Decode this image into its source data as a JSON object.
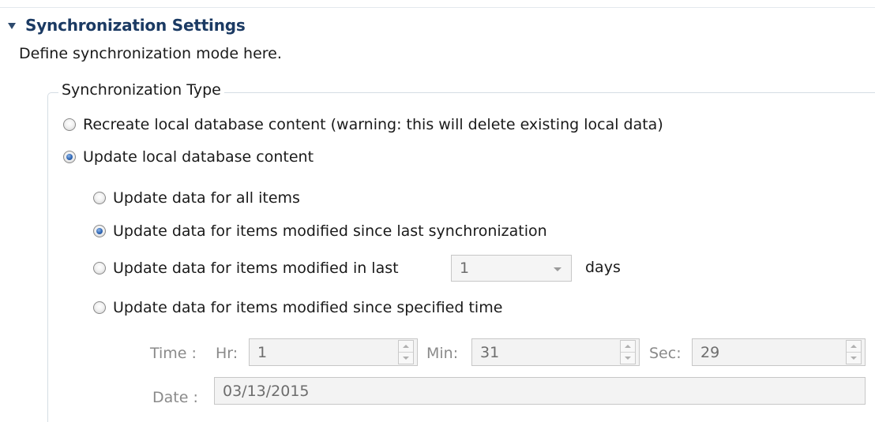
{
  "section": {
    "title": "Synchronization Settings",
    "description": "Define synchronization mode here."
  },
  "sync_type": {
    "group_label": "Synchronization Type",
    "options": [
      {
        "label": "Recreate local database content (warning: this will delete existing local data)",
        "selected": false
      },
      {
        "label": "Update local database content",
        "selected": true
      }
    ]
  },
  "update_mode": {
    "options": [
      {
        "label": "Update data for all items",
        "selected": false
      },
      {
        "label": "Update data for items modified since last synchronization",
        "selected": true
      },
      {
        "label": "Update data for items modified in last",
        "selected": false
      },
      {
        "label": "Update data for items modified since specified time",
        "selected": false
      }
    ],
    "days_combo_value": "1",
    "days_label": "days"
  },
  "time": {
    "time_label": "Time :",
    "hr_label": "Hr:",
    "hr_value": "1",
    "min_label": "Min:",
    "min_value": "31",
    "sec_label": "Sec:",
    "sec_value": "29",
    "date_label": "Date :",
    "date_value": "03/13/2015"
  }
}
